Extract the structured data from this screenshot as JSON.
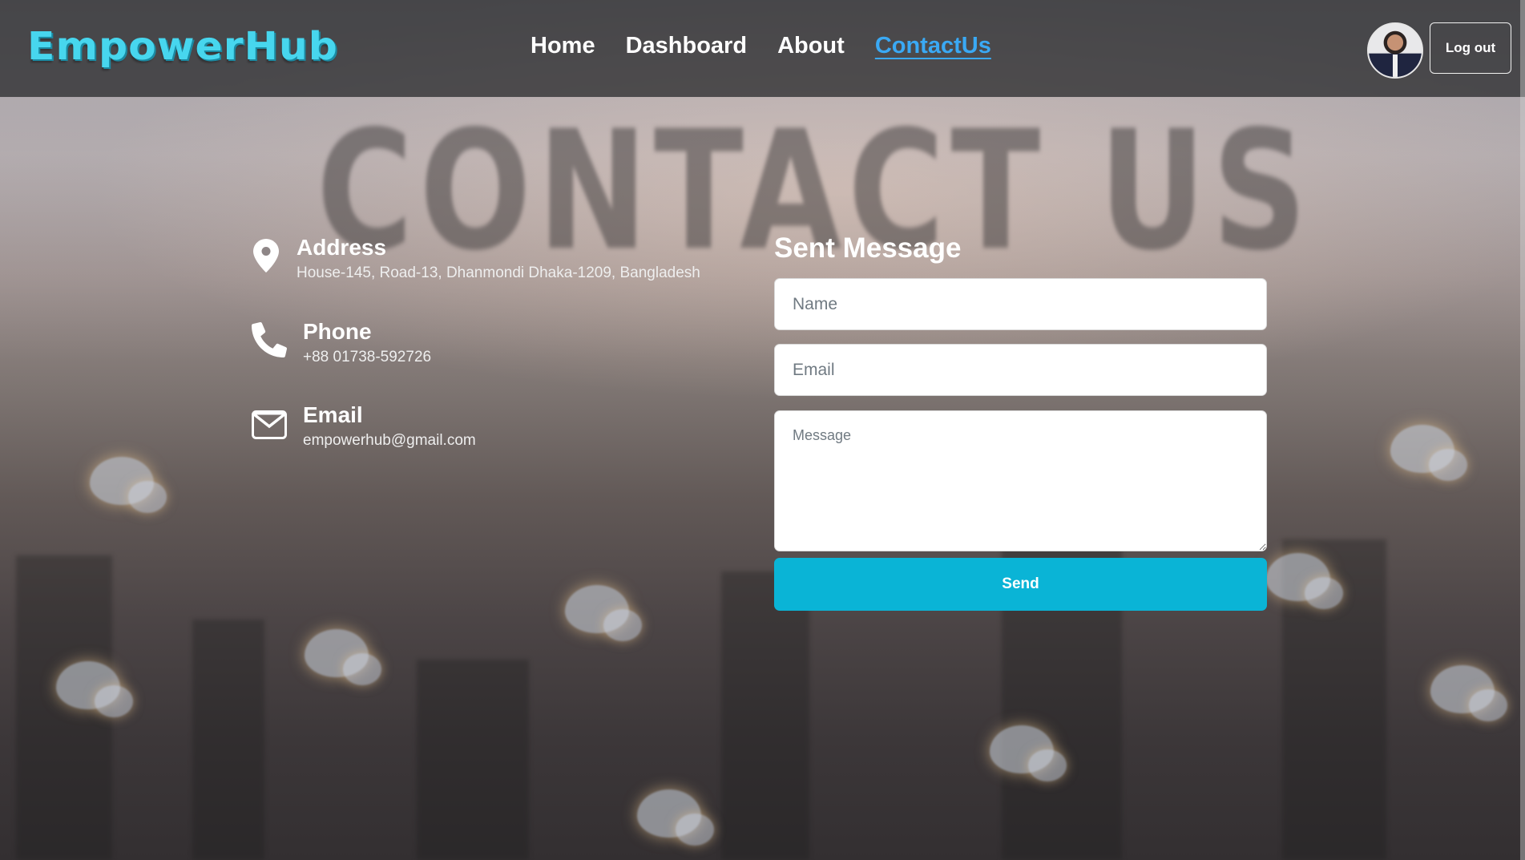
{
  "nav": {
    "logo": "EmpowerHub",
    "links": [
      {
        "label": "Home",
        "active": false
      },
      {
        "label": "Dashboard",
        "active": false
      },
      {
        "label": "About",
        "active": false
      },
      {
        "label": "ContactUs",
        "active": true
      }
    ],
    "logout_label": "Log out",
    "active_color": "#3aa9f4"
  },
  "hero": {
    "watermark": "CONTACT US"
  },
  "contact": {
    "address": {
      "title": "Address",
      "value": "House-145, Road-13, Dhanmondi Dhaka-1209, Bangladesh",
      "icon": "map-pin-icon"
    },
    "phone": {
      "title": "Phone",
      "value": "+88 01738-592726",
      "icon": "phone-icon"
    },
    "email": {
      "title": "Email",
      "value": "empowerhub@gmail.com",
      "icon": "envelope-icon"
    }
  },
  "form": {
    "title": "Sent Message",
    "name_placeholder": "Name",
    "email_placeholder": "Email",
    "message_placeholder": "Message",
    "send_label": "Send",
    "send_color": "#0ab4d6"
  }
}
